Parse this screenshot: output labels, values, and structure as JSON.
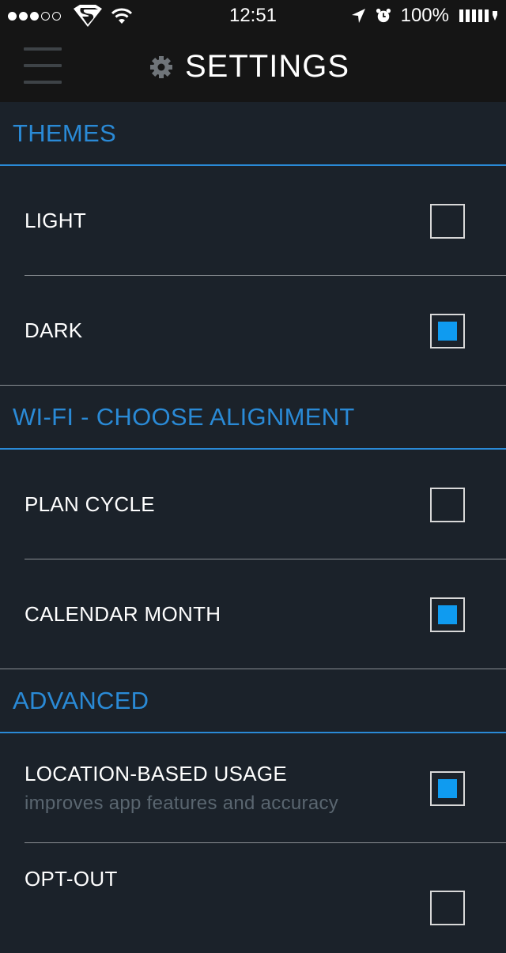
{
  "status_bar": {
    "time": "12:51",
    "battery": "100%",
    "signal_filled": 3,
    "signal_total": 5,
    "icons": [
      "superman-logo-icon",
      "wifi-icon",
      "location-arrow-icon",
      "alarm-clock-icon",
      "battery-icon"
    ]
  },
  "nav": {
    "title": "SETTINGS",
    "icons": [
      "menu-icon",
      "gear-icon"
    ]
  },
  "sections": {
    "themes": {
      "title": "THEMES",
      "light": {
        "label": "LIGHT",
        "checked": false
      },
      "dark": {
        "label": "DARK",
        "checked": true
      }
    },
    "wifi": {
      "title": "WI-FI - CHOOSE ALIGNMENT",
      "plan_cycle": {
        "label": "PLAN CYCLE",
        "checked": false
      },
      "calendar_month": {
        "label": "CALENDAR MONTH",
        "checked": true
      }
    },
    "advanced": {
      "title": "ADVANCED",
      "location_usage": {
        "label": "LOCATION-BASED USAGE",
        "sublabel": "improves app features and accuracy",
        "checked": true
      },
      "opt_out": {
        "label": "OPT-OUT",
        "checked": false
      }
    }
  },
  "colors": {
    "accent": "#2a8ad6",
    "checkbox_fill": "#0f9bf0",
    "background": "#1b222a",
    "bar_background": "#151515"
  }
}
